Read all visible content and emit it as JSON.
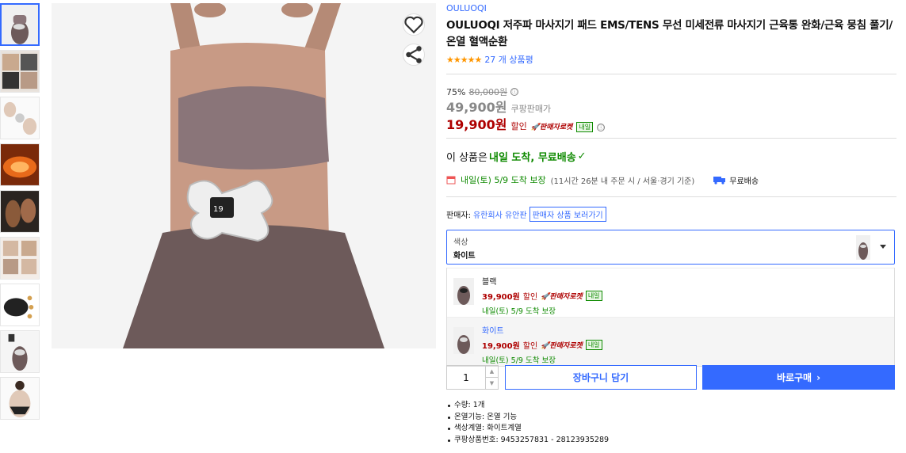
{
  "product": {
    "brand": "OULUOQI",
    "title": "OULUOQI 저주파 마사지기 패드 EMS/TENS 무선 미세전류 마사지기 근육통 완화/근육 뭉침 풀기/온열 혈액순환",
    "stars": "★★★★★",
    "review_count": "27 개 상품평"
  },
  "price": {
    "discount_rate": "75%",
    "original": "80,000원",
    "coupang_price": "49,900원",
    "coupang_label": "쿠팡판매가",
    "sale_price": "19,900원",
    "sale_label": "할인",
    "rocket_label": "🚀판매자로켓",
    "next_day_tag": "내일"
  },
  "shipping": {
    "arrival_prefix": "이 상품은",
    "arrival_green": "내일 도착, 무료배송",
    "arrival_date": "내일(토) 5/9 도착 보장",
    "arrival_sub": "(11시간 26분 내 주문 시 / 서울·경기 기준)",
    "free_label": "무료배송"
  },
  "seller": {
    "label": "판매자:",
    "name": "유한회사 유안판",
    "link": "판매자 상품 보러가기"
  },
  "option": {
    "label": "색상",
    "selected": "화이트",
    "items": [
      {
        "name": "블랙",
        "price": "39,900원",
        "sale": "할인",
        "rocket": "🚀판매자로켓",
        "tag": "내일",
        "delivery": "내일(토) 5/9 도착 보장"
      },
      {
        "name": "화이트",
        "price": "19,900원",
        "sale": "할인",
        "rocket": "🚀판매자로켓",
        "tag": "내일",
        "delivery": "내일(토) 5/9 도착 보장"
      }
    ]
  },
  "purchase": {
    "quantity": "1",
    "qty_up": "▲",
    "qty_down": "▼",
    "cart_label": "장바구니 담기",
    "buy_label": "바로구매",
    "buy_arrow": "›"
  },
  "specs": [
    "수량: 1개",
    "온열기능: 온열 기능",
    "색상계열: 화이트계열",
    "쿠팡상품번호: 9453257831 - 28123935289"
  ],
  "icons": {
    "heart": "heart-icon",
    "share": "share-icon",
    "info": "ⓘ",
    "check": "✓"
  },
  "colors": {
    "accent": "#346aff",
    "sale": "#ae0000",
    "delivery": "#0e8a00",
    "star": "#ff9600"
  }
}
